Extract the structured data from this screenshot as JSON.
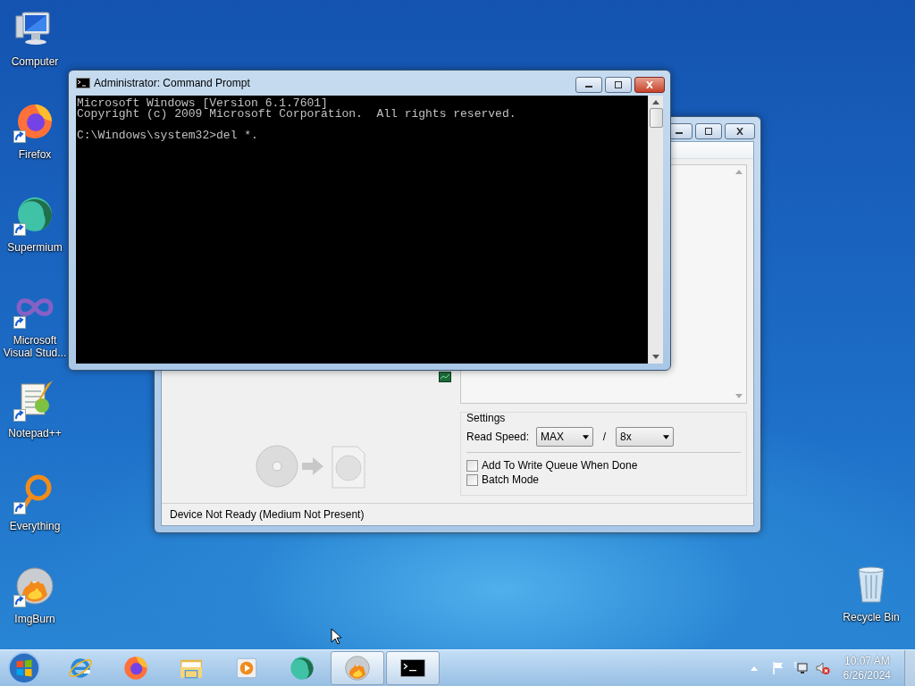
{
  "desktop_icons": [
    {
      "kind": "computer",
      "label": "Computer",
      "shortcut": false
    },
    {
      "kind": "firefox",
      "label": "Firefox",
      "shortcut": true
    },
    {
      "kind": "supermium",
      "label": "Supermium",
      "shortcut": true
    },
    {
      "kind": "visual-studio",
      "label": "Microsoft Visual Stud...",
      "shortcut": true
    },
    {
      "kind": "notepad",
      "label": "Notepad++",
      "shortcut": true
    },
    {
      "kind": "everything",
      "label": "Everything",
      "shortcut": true
    },
    {
      "kind": "imgburn",
      "label": "ImgBurn",
      "shortcut": true
    }
  ],
  "recycle_bin": {
    "label": "Recycle Bin"
  },
  "imgburn_window": {
    "settings": {
      "title": "Settings",
      "read_speed_label": "Read Speed:",
      "read_speed": "MAX",
      "separator": "/",
      "second_speed": "8x",
      "options": [
        {
          "label": "Add To Write Queue When Done",
          "checked": false
        },
        {
          "label": "Batch Mode",
          "checked": false
        }
      ]
    },
    "status_bar": "Device Not Ready (Medium Not Present)"
  },
  "command_prompt": {
    "title": "Administrator: Command Prompt",
    "output": [
      "Microsoft Windows [Version 6.1.7601]",
      "Copyright (c) 2009 Microsoft Corporation.  All rights reserved."
    ],
    "prompt": "C:\\Windows\\system32>del *."
  },
  "taskbar": {
    "items": [
      {
        "kind": "ie",
        "active": false
      },
      {
        "kind": "firefox",
        "active": false
      },
      {
        "kind": "folder",
        "active": false
      },
      {
        "kind": "media",
        "active": false
      },
      {
        "kind": "supermium",
        "active": false
      },
      {
        "kind": "imgburn",
        "active": true
      },
      {
        "kind": "cmd",
        "active": true
      }
    ],
    "clock": {
      "time": "10:07 AM",
      "date": "6/26/2024"
    }
  }
}
